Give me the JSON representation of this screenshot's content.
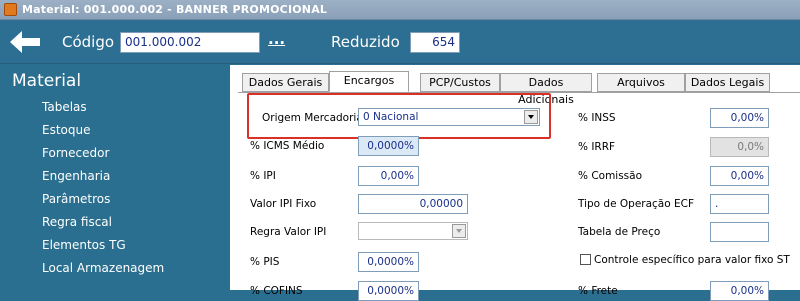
{
  "window": {
    "title": "Material: 001.000.002 - BANNER PROMOCIONAL"
  },
  "header": {
    "codigo_label": "Código",
    "codigo_value": "001.000.002",
    "lookup_label": "...",
    "reduzido_label": "Reduzido",
    "reduzido_value": "654"
  },
  "sidebar": {
    "title": "Material",
    "items": [
      {
        "label": "Tabelas"
      },
      {
        "label": "Estoque"
      },
      {
        "label": "Fornecedor"
      },
      {
        "label": "Engenharia"
      },
      {
        "label": "Parâmetros"
      },
      {
        "label": "Regra fiscal"
      },
      {
        "label": "Elementos TG"
      },
      {
        "label": "Local Armazenagem"
      }
    ]
  },
  "tabs": [
    {
      "label": "Dados Gerais",
      "active": false
    },
    {
      "label": "Encargos",
      "active": true
    },
    {
      "label": "PCP/Custos",
      "active": false
    },
    {
      "label": "Dados Adicionais",
      "active": false
    },
    {
      "label": "Arquivos",
      "active": false
    },
    {
      "label": "Dados Legais",
      "active": false
    }
  ],
  "form": {
    "origem_label": "Origem Mercadoria",
    "origem_value": "0 Nacional",
    "icms_label": "% ICMS Médio",
    "icms_value": "0,0000%",
    "ipi_label": "% IPI",
    "ipi_value": "0,00%",
    "ipi_fixo_label": "Valor IPI Fixo",
    "ipi_fixo_value": "0,00000",
    "regra_ipi_label": "Regra Valor IPI",
    "regra_ipi_value": "",
    "pis_label": "% PIS",
    "pis_value": "0,0000%",
    "cofins_label": "% COFINS",
    "cofins_value": "0,0000%",
    "inss_label": "% INSS",
    "inss_value": "0,00%",
    "irrf_label": "% IRRF",
    "irrf_value": "0,0%",
    "comissao_label": "% Comissão",
    "comissao_value": "0,00%",
    "tipo_ecf_label": "Tipo de Operação ECF",
    "tipo_ecf_value": ".",
    "tabela_preco_label": "Tabela de Preço",
    "tabela_preco_value": "",
    "controle_st_label": "Controle específico para valor fixo ST",
    "frete_label": "% Frete",
    "frete_value": "0,00%"
  },
  "colors": {
    "accent": "#2a6f8f",
    "highlight": "#d9302a"
  }
}
